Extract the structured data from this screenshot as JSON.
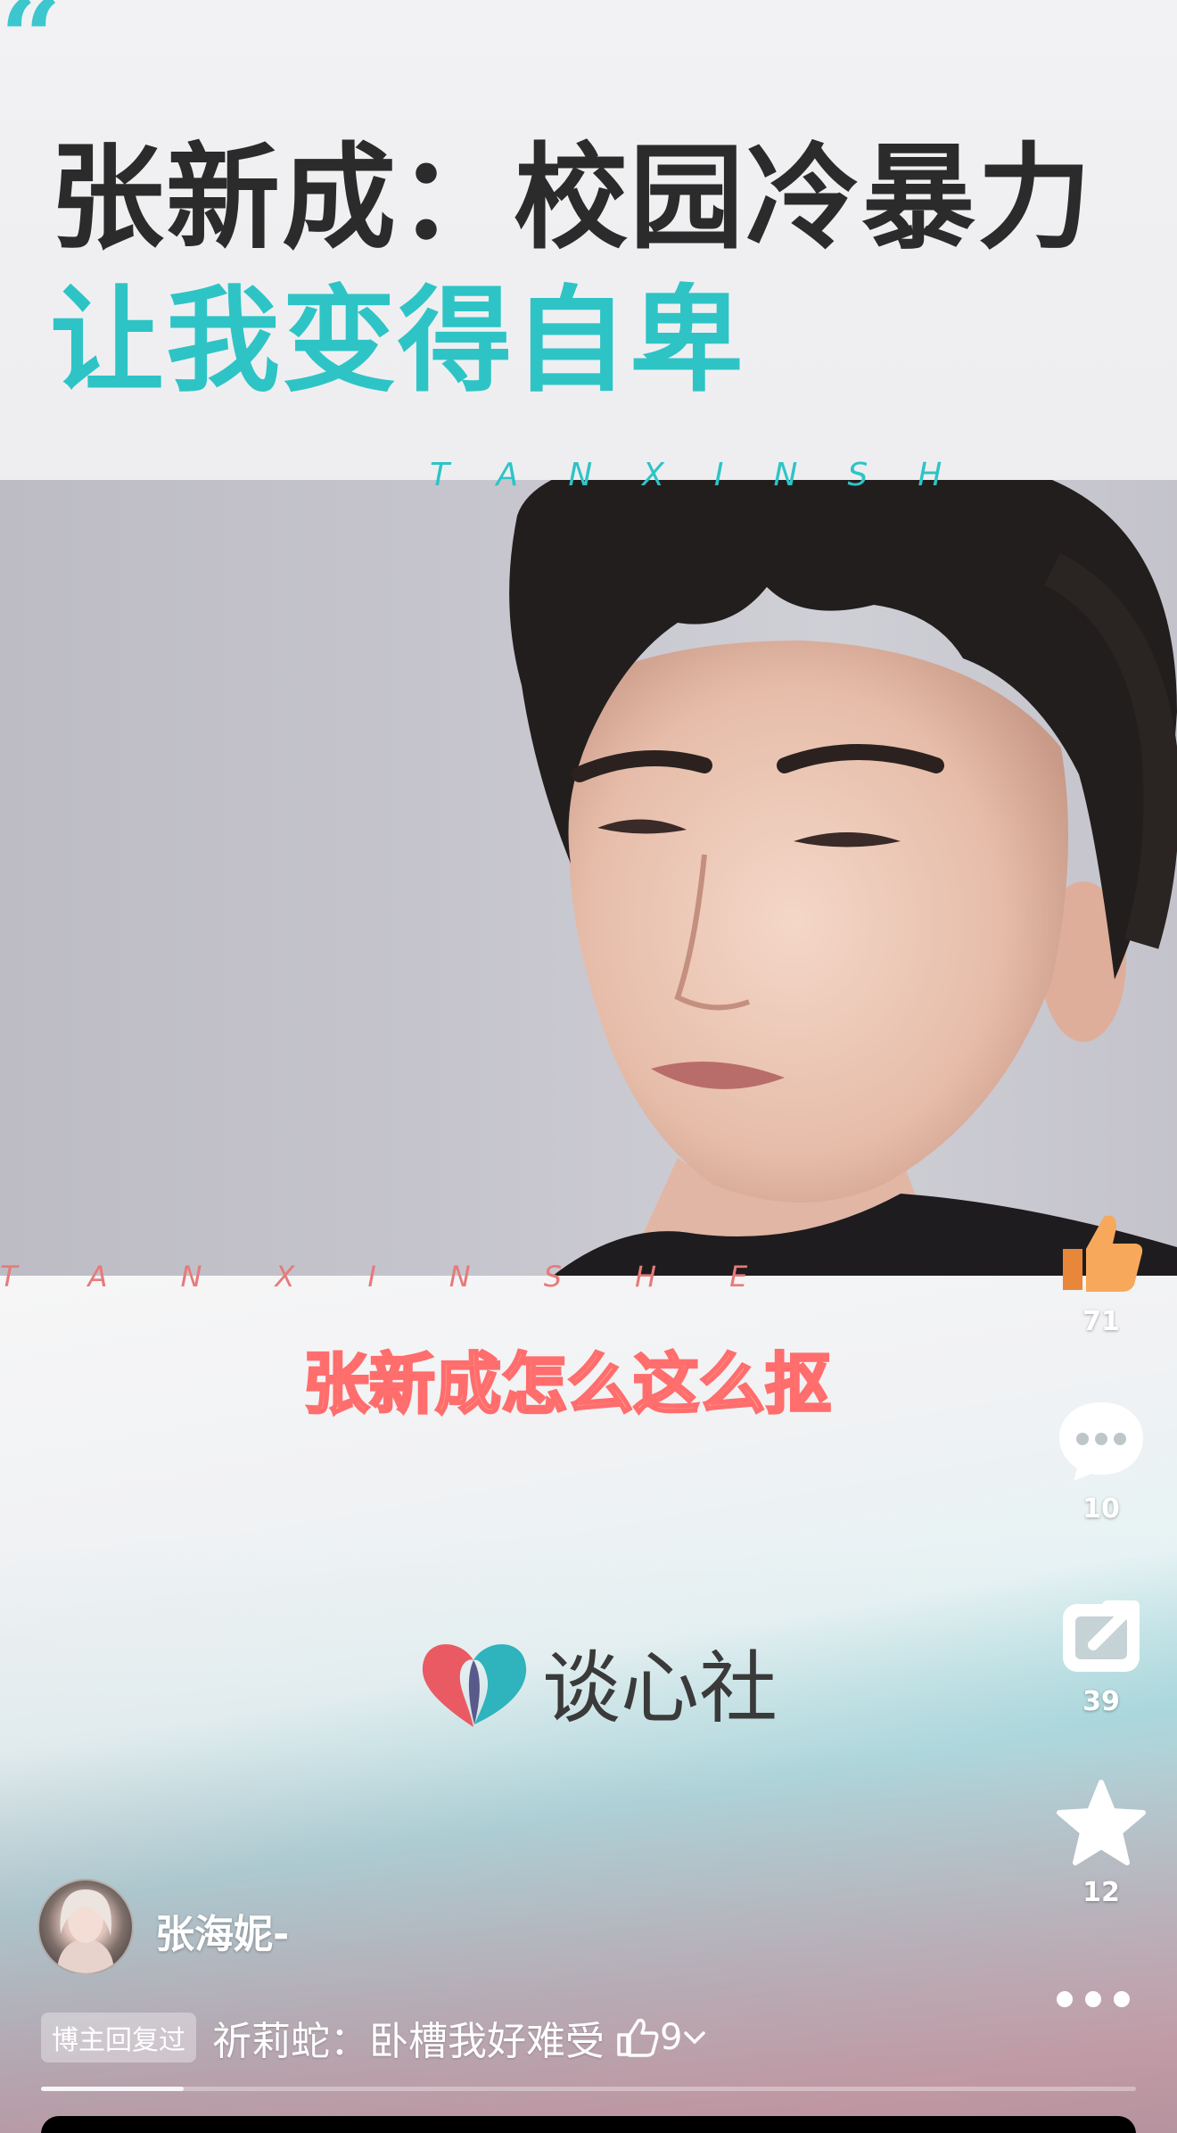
{
  "header": {
    "quote_glyph": "“",
    "title_line1": "张新成：校园冷暴力",
    "title_line2": "让我变得自卑"
  },
  "watermarks": {
    "top": "TANXINSH",
    "bottom": "TANXINSHE"
  },
  "video": {
    "subtitle": "张新成怎么这么抠",
    "brand": "谈心社"
  },
  "actions": {
    "likes": "71",
    "comments": "10",
    "shares": "39",
    "favorites": "12"
  },
  "author": {
    "username": "张海妮-"
  },
  "comment": {
    "badge": "博主回复过",
    "text": "祈莉蛇：卧槽我好难受",
    "likes": "9"
  },
  "playback": {
    "progress": 0.13
  },
  "colors": {
    "accent": "#2ec4c6",
    "title_dark": "#2b2b2b",
    "subtitle_fill": "#ffb3a0",
    "subtitle_stroke": "#ff6d6d",
    "like_orange": "#f5a04d"
  }
}
